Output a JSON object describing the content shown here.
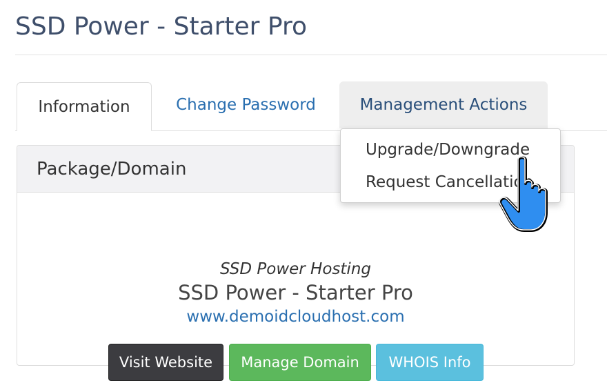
{
  "page": {
    "title": "SSD Power - Starter Pro"
  },
  "tabs": {
    "information": "Information",
    "change_password": "Change Password",
    "management_actions": "Management Actions"
  },
  "dropdown": {
    "items": [
      "Upgrade/Downgrade",
      "Request Cancellation"
    ]
  },
  "panel": {
    "heading": "Package/Domain",
    "product_group": "SSD Power Hosting",
    "product_name": "SSD Power - Starter Pro",
    "domain": "www.demoidcloudhost.com",
    "buttons": {
      "visit": "Visit Website",
      "manage_domain": "Manage Domain",
      "whois": "WHOIS Info"
    }
  },
  "colors": {
    "title": "#3f4f6b",
    "link": "#2a6fb0",
    "visit_button": "#3c3c40",
    "manage_button": "#5cb85c",
    "whois_button": "#5bc0de",
    "cursor": "#2f8ef0"
  },
  "icons": {
    "cursor": "hand-pointer-icon"
  }
}
